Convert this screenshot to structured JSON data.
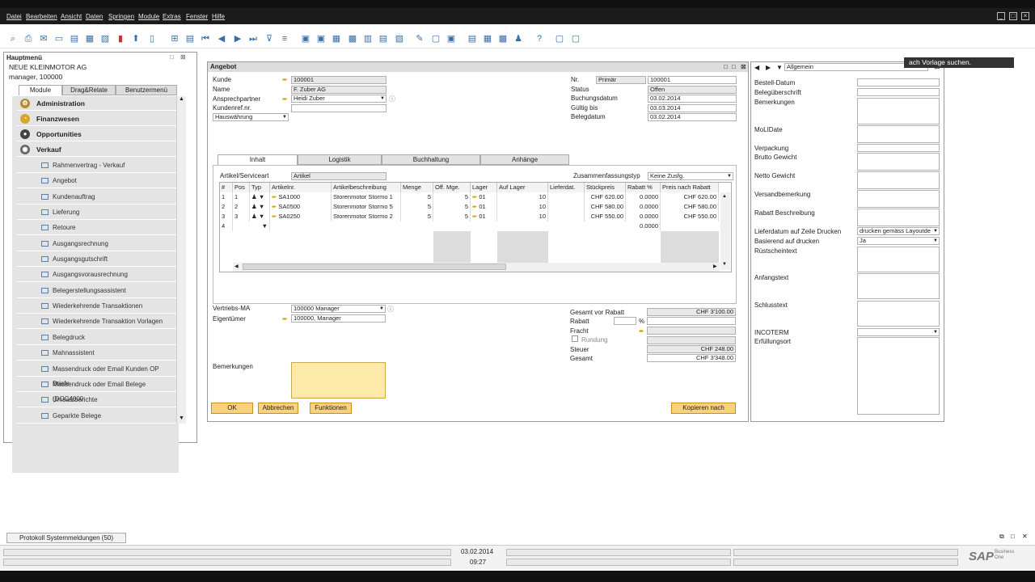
{
  "menubar": {
    "items": [
      "Datei",
      "Bearbeiten",
      "Ansicht",
      "Daten",
      "Springen",
      "Module",
      "Extras",
      "Fenster",
      "Hilfe"
    ]
  },
  "mainmenu": {
    "title": "Hauptmenü",
    "company": "NEUE KLEINMOTOR AG",
    "user": "manager, 100000",
    "tabs": [
      "Module",
      "Drag&Relate",
      "Benutzermenü"
    ],
    "modules": [
      "Administration",
      "Finanzwesen",
      "Opportunities",
      "Verkauf"
    ],
    "items": [
      "Rahmenvertrag - Verkauf",
      "Angebot",
      "Kundenauftrag",
      "Lieferung",
      "Retoure",
      "Ausgangsrechnung",
      "Ausgangsgutschrift",
      "Ausgangsvorausrechnung",
      "Belegerstellungsassistent",
      "Wiederkehrende Transaktionen",
      "Wiederkehrende Transaktion Vorlagen",
      "Belegdruck",
      "Mahnassistent",
      "Massendruck oder Email Kunden OP Briefe",
      "Massendruck oder Email Belege (DOC4000",
      "Umsatzberichte",
      "Geparkte Belege"
    ]
  },
  "angebot": {
    "title": "Angebot",
    "labels": {
      "kunde": "Kunde",
      "name": "Name",
      "ansprech": "Ansprechpartner",
      "kundenref": "Kundenref.nr.",
      "nr": "Nr.",
      "status": "Status",
      "buchung": "Buchungsdatum",
      "gueltig": "Gültig bis",
      "beleg": "Belegdatum",
      "artikelart": "Artikel/Serviceart",
      "zusammen": "Zusammenfassungstyp",
      "vertrieb": "Vertriebs-MA",
      "eigentuemer": "Eigentümer",
      "bemerkungen": "Bemerkungen",
      "gesamtvor": "Gesamt vor Rabatt",
      "rabatt": "Rabatt",
      "fracht": "Fracht",
      "rundung": "Rundung",
      "steuer": "Steuer",
      "gesamt": "Gesamt",
      "pct": "%"
    },
    "values": {
      "kunde": "100001",
      "name": "F. Zuber AG",
      "ansprech": "Heidi Zuber",
      "kundenref": "",
      "waehrung": "Hauswährung",
      "nr_series": "Primär",
      "nr": "100001",
      "status": "Offen",
      "buchung": "03.02.2014",
      "gueltig": "03.03.2014",
      "beleg": "03.02.2014",
      "artikelart": "Artikel",
      "zusammen": "Keine Zusfg.",
      "vertrieb": "100000 Manager",
      "eigentuemer": "100000, Manager",
      "gesamtvor": "CHF 3'100.00",
      "steuer": "CHF 248.00",
      "gesamt": "CHF 3'348.00"
    },
    "tabs": [
      "Inhalt",
      "Logistik",
      "Buchhaltung",
      "Anhänge"
    ],
    "columns": [
      "#",
      "Pos",
      "Typ",
      "Artikelnr.",
      "Artikelbeschreibung",
      "Menge",
      "Off. Mge.",
      "Lager",
      "Auf Lager",
      "Lieferdat.",
      "Stückpreis",
      "Rabatt %",
      "Preis nach Rabatt"
    ],
    "rows": [
      [
        "1",
        "1",
        "",
        "SA1000",
        "Storenmotor Stormo 1",
        "5",
        "5",
        "01",
        "10",
        "",
        "CHF 620.00",
        "0.0000",
        "CHF 620.00"
      ],
      [
        "2",
        "2",
        "",
        "SA0500",
        "Storenmotor Stormo 5",
        "5",
        "5",
        "01",
        "10",
        "",
        "CHF 580.00",
        "0.0000",
        "CHF 580.00"
      ],
      [
        "3",
        "3",
        "",
        "SA0250",
        "Storenmotor Stormo 2",
        "5",
        "5",
        "01",
        "10",
        "",
        "CHF 550.00",
        "0.0000",
        "CHF 550.00"
      ],
      [
        "4",
        "",
        "",
        "",
        "",
        "",
        "",
        "",
        "",
        "",
        "",
        "0.0000",
        ""
      ]
    ],
    "buttons": {
      "ok": "OK",
      "abbrechen": "Abbrechen",
      "funktionen": "Funktionen",
      "kopieren": "Kopieren nach"
    }
  },
  "rightpanel": {
    "dropdown": "Allgemein",
    "tooltip": "ach Vorlage suchen.",
    "fields": [
      "Bestell-Datum",
      "Belegüberschrift",
      "Bemerkungen",
      "MoLIDate",
      "Verpackung",
      "Brutto Gewicht",
      "Netto Gewicht",
      "Versandbemerkung",
      "Rabatt Beschreibung",
      "Lieferdatum auf Zeile Drucken",
      "Basierend auf drucken",
      "Rüstscheintext",
      "Anfangstext",
      "Schlusstext",
      "INCOTERM",
      "Erfüllungsort"
    ],
    "lieferdatum_value": "drucken gemäss Layoutde",
    "basierend_value": "Ja"
  },
  "status": {
    "protokoll": "Protokoll Systemmeldungen (50)",
    "date": "03.02.2014",
    "time": "09:27",
    "brand": "SAP",
    "brand_sub": "Business One"
  }
}
